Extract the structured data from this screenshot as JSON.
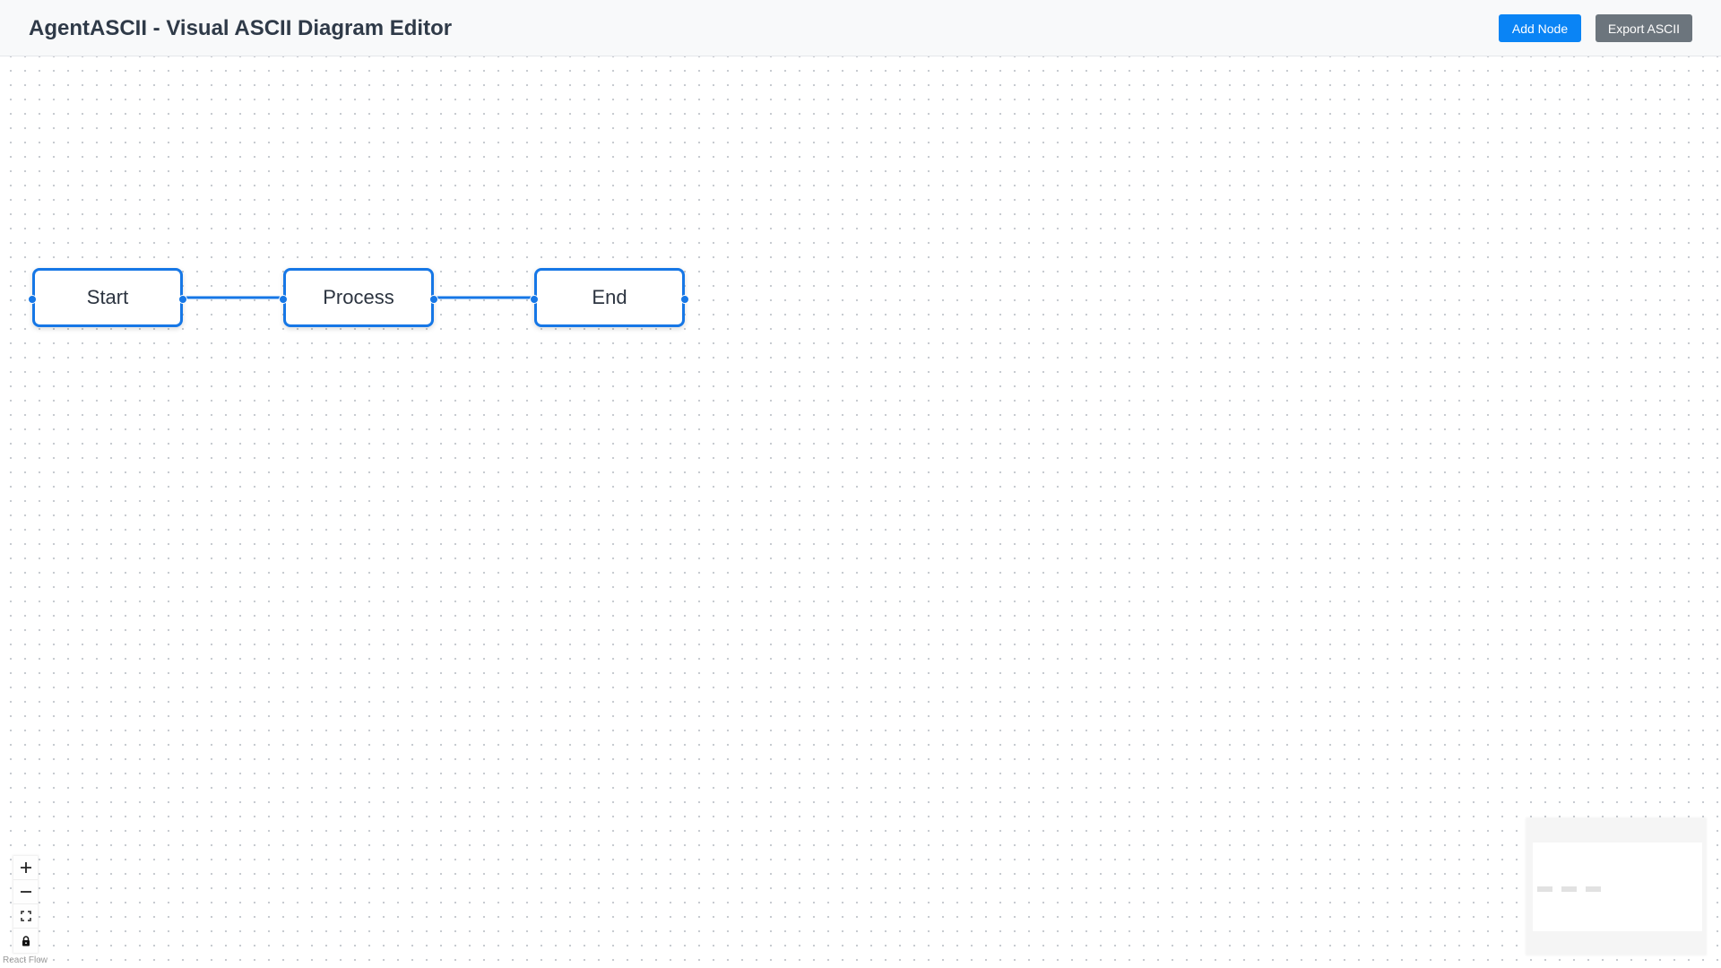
{
  "header": {
    "title": "AgentASCII - Visual ASCII Diagram Editor",
    "add_node_label": "Add Node",
    "export_label": "Export ASCII"
  },
  "diagram": {
    "nodes": [
      {
        "id": "start",
        "label": "Start"
      },
      {
        "id": "process",
        "label": "Process"
      },
      {
        "id": "end",
        "label": "End"
      }
    ],
    "edges": [
      {
        "from": "start",
        "to": "process"
      },
      {
        "from": "process",
        "to": "end"
      }
    ]
  },
  "controls": {
    "zoom_in_icon": "plus-icon",
    "zoom_out_icon": "minus-icon",
    "fit_view_icon": "fit-view-icon",
    "lock_icon": "lock-icon"
  },
  "attribution": "React Flow",
  "colors": {
    "accent": "#1677e6",
    "primary_button": "#0a84f5",
    "secondary_button": "#6c757d",
    "header_bg": "#f8f9fa",
    "title_text": "#2f3a48"
  }
}
